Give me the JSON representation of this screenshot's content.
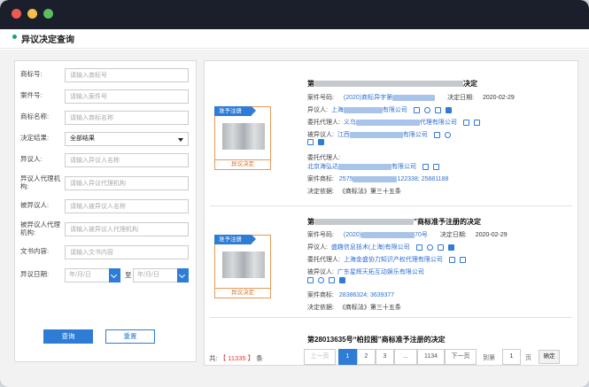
{
  "window": {
    "controls": [
      "close",
      "minimize",
      "maximize"
    ]
  },
  "header": {
    "title": "异议决定查询"
  },
  "form": {
    "fields": [
      {
        "label": "商标号:",
        "placeholder": "请输入商标号"
      },
      {
        "label": "案件号:",
        "placeholder": "请输入案件号"
      },
      {
        "label": "商标名称:",
        "placeholder": "请输入商标名称"
      },
      {
        "label": "决定结果:",
        "value": "全部结果"
      },
      {
        "label": "异议人:",
        "placeholder": "请输入异议人名称"
      },
      {
        "label": "异议人代理机构:",
        "placeholder": "请输入异议代理机构"
      },
      {
        "label": "被异议人:",
        "placeholder": "请输入被异议人名称"
      },
      {
        "label": "被异议人代理机构:",
        "placeholder": "请输入被异议人代理机构"
      },
      {
        "label": "文书内容:",
        "placeholder": "请输入文书内容"
      }
    ],
    "date_label": "异议日期:",
    "date_from_placeholder": "年/月/日",
    "date_to_placeholder": "年/月/日",
    "date_to_text": "至",
    "query_button": "查询",
    "reset_button": "重置"
  },
  "cards": [
    {
      "tag": "准予注册",
      "status": "异议决定",
      "title_prefix": "第",
      "title_suffix": "决定",
      "case_label": "案件号码:",
      "case_value": "(2020)商标异字第",
      "date_label": "决定日期:",
      "date_value": "2020-02-29",
      "opponent_label": "异议人:",
      "opponent_value": "上海",
      "opponent_suffix": "有限公司",
      "opp_agent_label": "委托代理人:",
      "opp_agent_prefix": "义乌",
      "opp_agent_suffix": "代理有限公司",
      "respondent_label": "被异议人:",
      "respondent_value": "江西",
      "respondent_suffix": "有限公司",
      "resp_agent_label": "委托代理人:",
      "resp_agent_prefix": "北京海弘达",
      "resp_agent_suffix": "有限公司",
      "tm_label": "案件商标:",
      "tm_prefix": "2575",
      "tm_suffix": "122338; 25881188",
      "basis_label": "决定依据:",
      "basis_value": "《商标法》第三十五条"
    },
    {
      "tag": "准予注册",
      "status": "异议决定",
      "title_prefix": "第",
      "title_suffix": "”商标准予注册的决定",
      "case_label": "案件号码:",
      "case_value": "(2020)",
      "case_suffix": "70号",
      "date_label": "决定日期:",
      "date_value": "2020-02-29",
      "opponent_label": "异议人:",
      "opponent_value": "盛趣信息技术(上海)有限公司",
      "opp_agent_label": "委托代理人:",
      "opp_agent_value": "上海金盛协力知识产权代理有限公司",
      "respondent_label": "被异议人:",
      "respondent_value": "广东星辉天拓互动娱乐有限公司",
      "tm_label": "案件商标:",
      "tm_value": "28386324; 3639377",
      "basis_label": "决定依据:",
      "basis_value": "《商标法》第三十五条"
    },
    {
      "title": "第28013635号“柏拉图”商标准予注册的决定"
    }
  ],
  "pagination": {
    "total_prefix": "共:",
    "total_count": "【 11335 】",
    "total_suffix": "条",
    "prev": "上一页",
    "pages": [
      "1",
      "2",
      "3",
      "...",
      "1134"
    ],
    "next": "下一页",
    "goto_label": "到第",
    "goto_value": "1",
    "page_unit": "页",
    "confirm": "确定"
  },
  "colors": {
    "accent": "#2e7cd6",
    "status_orange": "#e06a1a",
    "total_red": "#e23b3b",
    "header_bullet": "#1aa36a"
  }
}
